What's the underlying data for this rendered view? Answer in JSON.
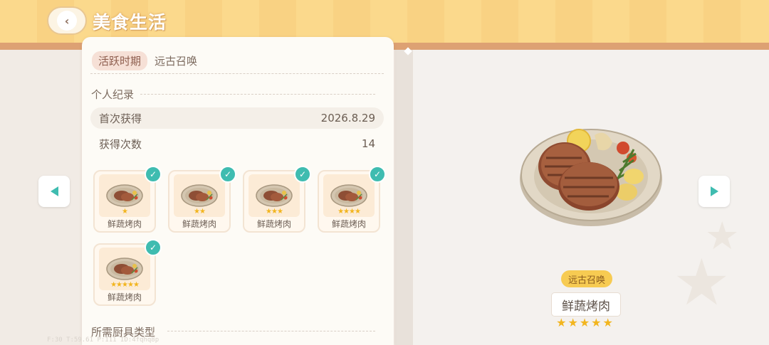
{
  "header": {
    "title": "美食生活",
    "back_icon": "chevron-left-icon"
  },
  "card": {
    "period_label": "活跃时期",
    "period_value": "远古召唤",
    "personal_record_title": "个人纪录",
    "first_obtained_label": "首次获得",
    "first_obtained_value": "2026.8.29",
    "times_obtained_label": "获得次数",
    "times_obtained_value": "14",
    "dishes": [
      {
        "name": "鲜蔬烤肉",
        "stars": "★",
        "star_count": 1,
        "checked": true
      },
      {
        "name": "鲜蔬烤肉",
        "stars": "★★",
        "star_count": 2,
        "checked": true
      },
      {
        "name": "鲜蔬烤肉",
        "stars": "★★★",
        "star_count": 3,
        "checked": true
      },
      {
        "name": "鲜蔬烤肉",
        "stars": "★★★★",
        "star_count": 4,
        "checked": true
      },
      {
        "name": "鲜蔬烤肉",
        "stars": "★★★★★",
        "star_count": 5,
        "checked": true
      }
    ],
    "tools_title": "所需厨具类型"
  },
  "detail": {
    "source_badge": "远古召唤",
    "dish_name": "鲜蔬烤肉",
    "stars": "★★★★★",
    "star_count": 5
  },
  "debug_text": "F:30  T:59.61  P:111  ID:4fqhq8p",
  "colors": {
    "accent": "#3fbcb0",
    "star": "#f2b51e",
    "banner": "#fbd98c"
  }
}
